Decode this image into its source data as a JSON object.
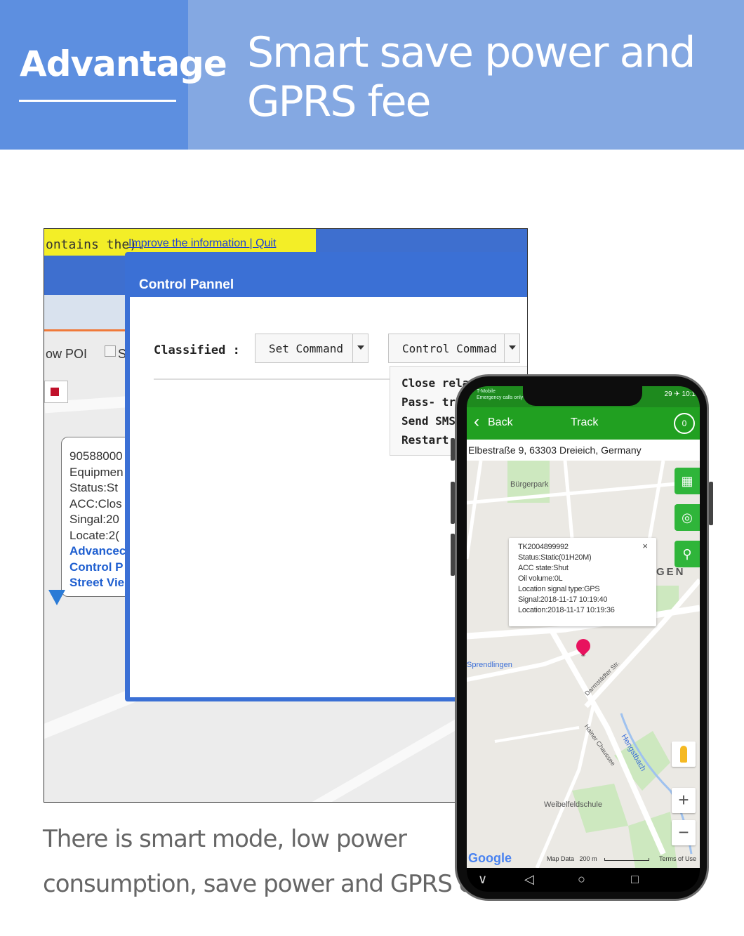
{
  "banner": {
    "tag": "Advantage",
    "headline": "Smart save power and GPRS fee",
    "colors": {
      "left": "#5d8fe0",
      "right": "#84a8e2"
    }
  },
  "web_panel": {
    "yellow_notice": "ontains the).",
    "yellow_link": "Improve the information | Quit",
    "show_poi": "ow POI",
    "checkbox_label": "S",
    "popup": {
      "lines": [
        "90588000",
        "Equipmen",
        "Status:St",
        "ACC:Clos",
        "Singal:20",
        "Locate:2("
      ],
      "links": [
        "Advancec",
        "Control P",
        "Street Vie"
      ]
    },
    "dialog": {
      "title": "Control Pannel",
      "classified_label": "Classified :",
      "command_select": "Set Command",
      "control_select": "Control Commad",
      "options": [
        "Close relay |Open r",
        "Pass- trough",
        "Send SMS",
        "Restart"
      ]
    }
  },
  "caption": {
    "line1": "There is smart  mode,  low power",
    "line2": "consumption, save power and  GPRS cost"
  },
  "phone": {
    "carrier": "T-Mobile",
    "carrier_sub": "Emergency calls only",
    "status_right": "29 ✈ 10:1",
    "app": {
      "back_label": "Back",
      "title": "Track",
      "refresh_icon": "refresh-icon",
      "refresh_count": "0",
      "address": "Elbestraße 9, 63303 Dreieich, Germany"
    },
    "map": {
      "labels": {
        "park": "Bürgerpark",
        "sprendlingen": "Sprendlingen",
        "school": "Weibelfeldschule",
        "gen": "GEN",
        "hengst": "Hengstbach",
        "darm": "Darmstädter Str.",
        "hainer": "Hainer Chaussee"
      },
      "info": {
        "device": "TK2004899992",
        "status": "Status:Static(01H20M)",
        "acc": "ACC state:Shut",
        "oil": "Oil volume:0L",
        "signal_type": "Location signal type:GPS",
        "signal": "Signal:2018-11-17 10:19:40",
        "location": "Location:2018-11-17 10:19:36"
      },
      "zoom_in": "+",
      "zoom_out": "−",
      "map_data": "Map Data",
      "scale": "200 m",
      "terms": "Terms of Use",
      "google": "Google"
    },
    "nav": {
      "back": "∨",
      "home_left": "◁",
      "home": "○",
      "recent": "□"
    }
  }
}
